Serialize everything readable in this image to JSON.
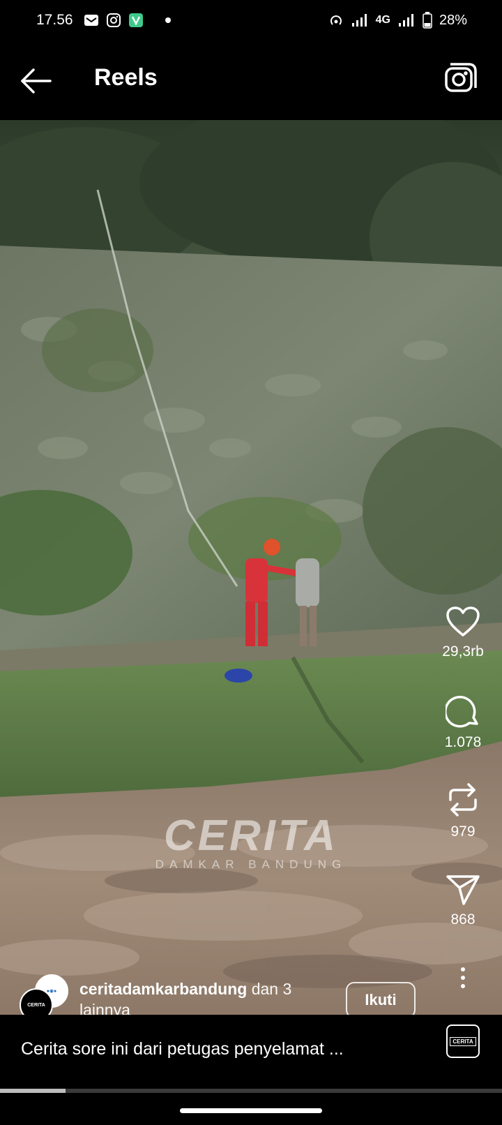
{
  "status_bar": {
    "time": "17.56",
    "network": "4G",
    "battery": "28%",
    "icons": [
      "mail-icon",
      "instagram-icon",
      "vpn-icon",
      "dot-icon",
      "hotspot-icon",
      "signal-icon",
      "battery-icon"
    ]
  },
  "header": {
    "title": "Reels",
    "back_icon": "arrow-left-icon",
    "camera_icon": "camera-icon"
  },
  "video": {
    "watermark_main": "CERITA",
    "watermark_sub": "DAMKAR BANDUNG"
  },
  "actions": {
    "like_count": "29,3rb",
    "comment_count": "1.078",
    "repost_count": "979",
    "share_count": "868"
  },
  "owner": {
    "username": "ceritadamkarbandung",
    "extra": "dan 3 lainnya",
    "avatar_text": "CERITA"
  },
  "follow_label": "Ikuti",
  "caption": "Cerita sore ini dari petugas penyelamat ...",
  "audio_label": "CERITA",
  "progress": 0.13,
  "colors": {
    "background": "#000000",
    "text": "#ffffff"
  }
}
